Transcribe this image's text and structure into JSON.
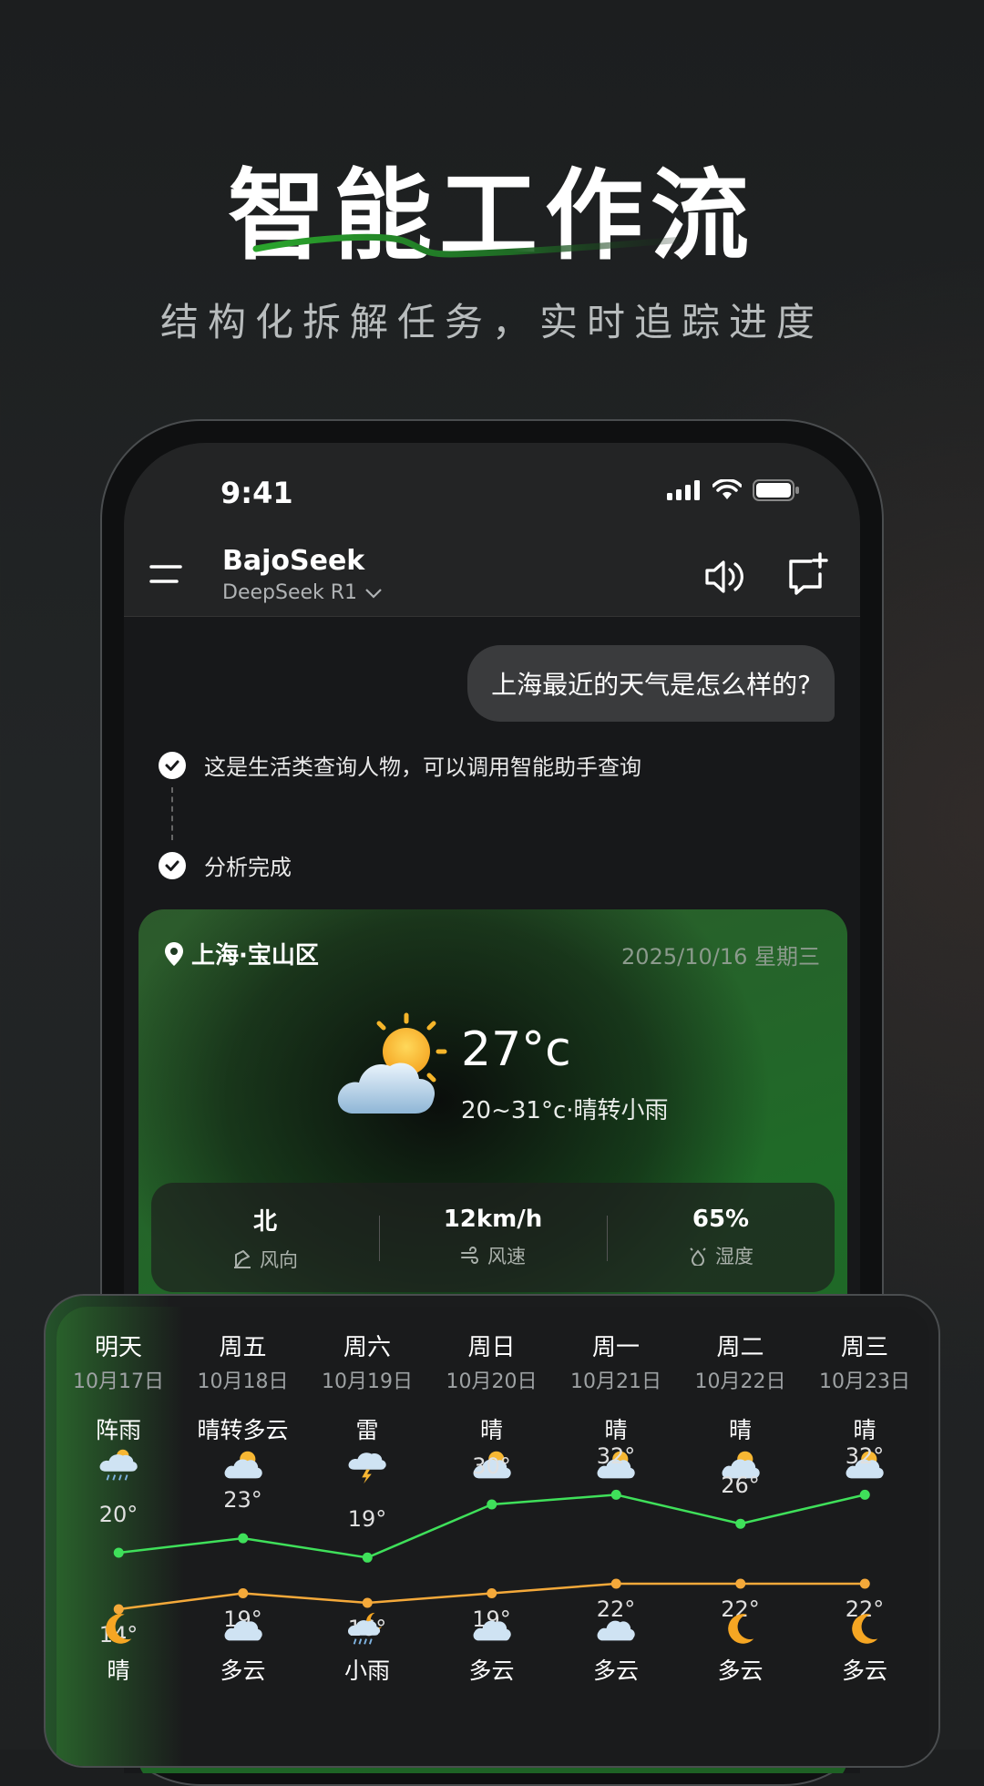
{
  "promo": {
    "title": "智能工作流",
    "subtitle": "结构化拆解任务，实时追踪进度"
  },
  "status_bar": {
    "time": "9:41"
  },
  "header": {
    "app_name": "BajoSeek",
    "model": "DeepSeek R1"
  },
  "chat": {
    "user_message": "上海最近的天气是怎么样的?",
    "steps": [
      {
        "label": "这是生活类查询人物，可以调用智能助手查询"
      },
      {
        "label": "分析完成"
      }
    ]
  },
  "weather": {
    "location": "上海·宝山区",
    "date": "2025/10/16 星期三",
    "temperature": "27°c",
    "range": "20~31°c·晴转小雨",
    "metrics": [
      {
        "value": "北",
        "label": "风向",
        "icon": "wind-direction-icon"
      },
      {
        "value": "12km/h",
        "label": "风速",
        "icon": "wind-speed-icon"
      },
      {
        "value": "65%",
        "label": "湿度",
        "icon": "humidity-icon"
      }
    ]
  },
  "forecast": {
    "days": [
      {
        "day": "明天",
        "date": "10月17日",
        "condition": "阵雨",
        "icon": "shower-icon",
        "high": "20°",
        "low": "14°",
        "night_icon": "moon-icon",
        "night_condition": "晴"
      },
      {
        "day": "周五",
        "date": "10月18日",
        "condition": "晴转多云",
        "icon": "partly-cloudy-icon",
        "high": "23°",
        "low": "19°",
        "night_icon": "cloudy-icon",
        "night_condition": "多云"
      },
      {
        "day": "周六",
        "date": "10月19日",
        "condition": "雷",
        "icon": "thunder-icon",
        "high": "19°",
        "low": "16°",
        "night_icon": "night-rain-icon",
        "night_condition": "小雨"
      },
      {
        "day": "周日",
        "date": "10月20日",
        "condition": "晴",
        "icon": "partly-cloudy-icon",
        "high": "30°",
        "low": "19°",
        "night_icon": "cloudy-icon",
        "night_condition": "多云"
      },
      {
        "day": "周一",
        "date": "10月21日",
        "condition": "晴",
        "icon": "partly-cloudy-icon",
        "high": "32°",
        "low": "22°",
        "night_icon": "cloudy-icon",
        "night_condition": "多云"
      },
      {
        "day": "周二",
        "date": "10月22日",
        "condition": "晴",
        "icon": "partly-cloudy-icon",
        "high": "26°",
        "low": "22°",
        "night_icon": "moon-icon",
        "night_condition": "多云"
      },
      {
        "day": "周三",
        "date": "10月23日",
        "condition": "晴",
        "icon": "partly-cloudy-icon",
        "high": "32°",
        "low": "22°",
        "night_icon": "moon-icon",
        "night_condition": "多云"
      }
    ],
    "high_values": [
      20,
      23,
      19,
      30,
      32,
      26,
      32
    ],
    "low_values": [
      14,
      19,
      16,
      19,
      22,
      22,
      22
    ],
    "high_color": "#3fe05a",
    "low_color": "#f4a93a"
  }
}
